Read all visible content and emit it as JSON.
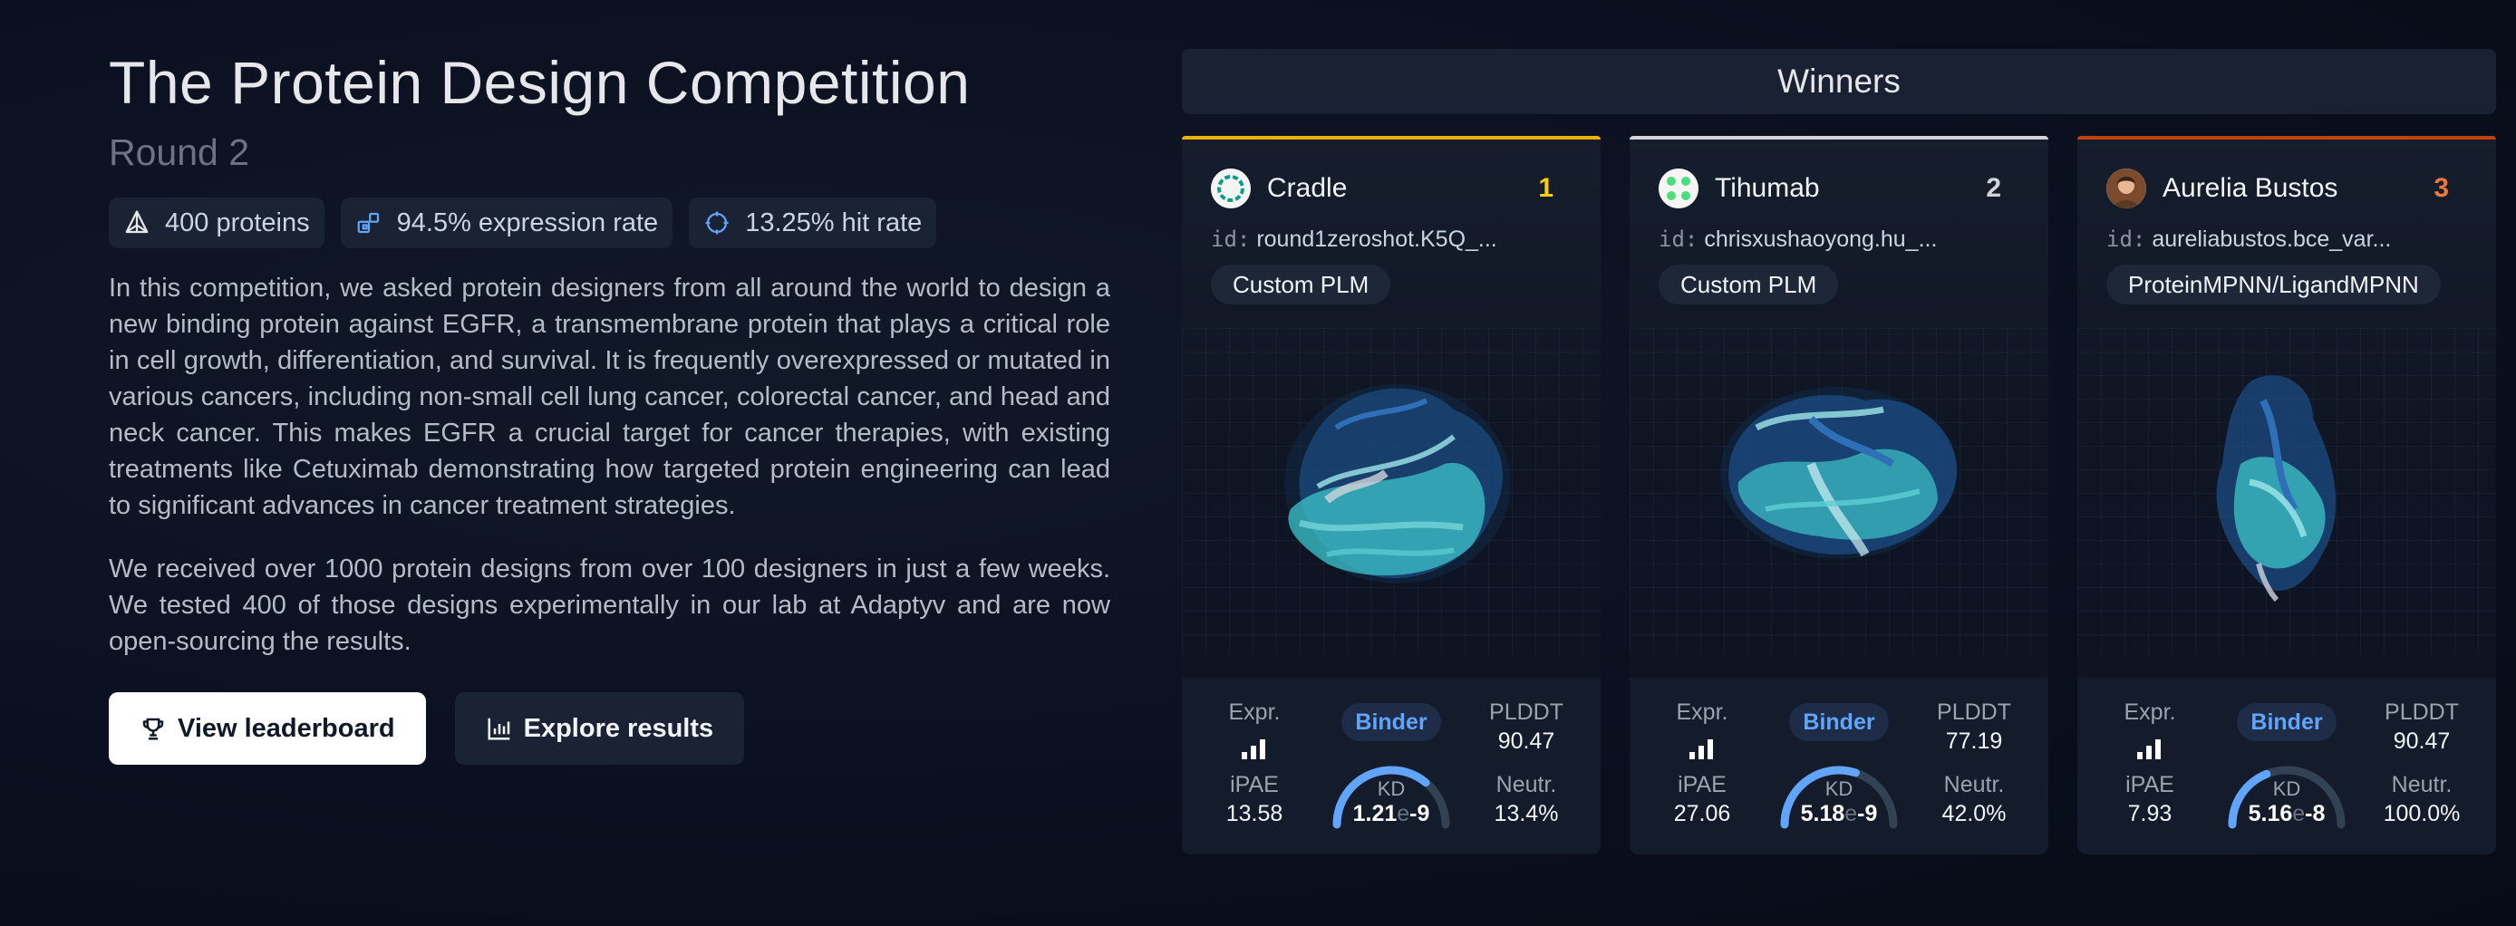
{
  "hero": {
    "title": "The Protein Design Competition",
    "subtitle": "Round 2",
    "stats": [
      {
        "icon": "cube-outline-icon",
        "label": "400 proteins"
      },
      {
        "icon": "grid-blocks-icon",
        "label": "94.5% expression rate"
      },
      {
        "icon": "target-icon",
        "label": "13.25% hit rate"
      }
    ],
    "paragraphs": [
      "In this competition, we asked protein designers from all around the world to design a new binding protein against EGFR, a transmembrane protein that plays a critical role in cell growth, differentiation, and survival. It is frequently overexpressed or mutated in various cancers, including non-small cell lung cancer, colorectal cancer, and head and neck cancer. This makes EGFR a crucial target for cancer therapies, with existing treatments like Cetuximab demonstrating how targeted protein engineering can lead to significant advances in cancer treatment strategies.",
      "We received over 1000 protein designs from over 100 designers in just a few weeks. We tested 400 of those designs experimentally in our lab at Adaptyv and are now open-sourcing the results."
    ],
    "buttons": {
      "leaderboard": "View leaderboard",
      "explore": "Explore results"
    }
  },
  "winners": {
    "heading": "Winners",
    "labels": {
      "id_prefix": "id:",
      "expr": "Expr.",
      "binder": "Binder",
      "plddt": "PLDDT",
      "ipae": "iPAE",
      "neutr": "Neutr.",
      "kd": "KD"
    },
    "cards": [
      {
        "name": "Cradle",
        "rank": "1",
        "rank_color": "#facc15",
        "id": "round1zeroshot.K5Q_...",
        "model": "Custom PLM",
        "expression_level": 3,
        "plddt": "90.47",
        "ipae": "13.58",
        "neutr": "13.4%",
        "kd_mantissa": "1.21",
        "kd_e": "e",
        "kd_exp": "-9",
        "kd_gauge_fraction": 0.72
      },
      {
        "name": "Tihumab",
        "rank": "2",
        "rank_color": "#d1d5db",
        "id": "chrisxushaoyong.hu_...",
        "model": "Custom PLM",
        "expression_level": 3,
        "plddt": "77.19",
        "ipae": "27.06",
        "neutr": "42.0%",
        "kd_mantissa": "5.18",
        "kd_e": "e",
        "kd_exp": "-9",
        "kd_gauge_fraction": 0.6
      },
      {
        "name": "Aurelia Bustos",
        "rank": "3",
        "rank_color": "#ea7a3a",
        "id": "aureliabustos.bce_var...",
        "model": "ProteinMPNN/LigandMPNN",
        "expression_level": 3,
        "plddt": "90.47",
        "ipae": "7.93",
        "neutr": "100.0%",
        "kd_mantissa": "5.16",
        "kd_e": "e",
        "kd_exp": "-8",
        "kd_gauge_fraction": 0.38
      }
    ]
  }
}
